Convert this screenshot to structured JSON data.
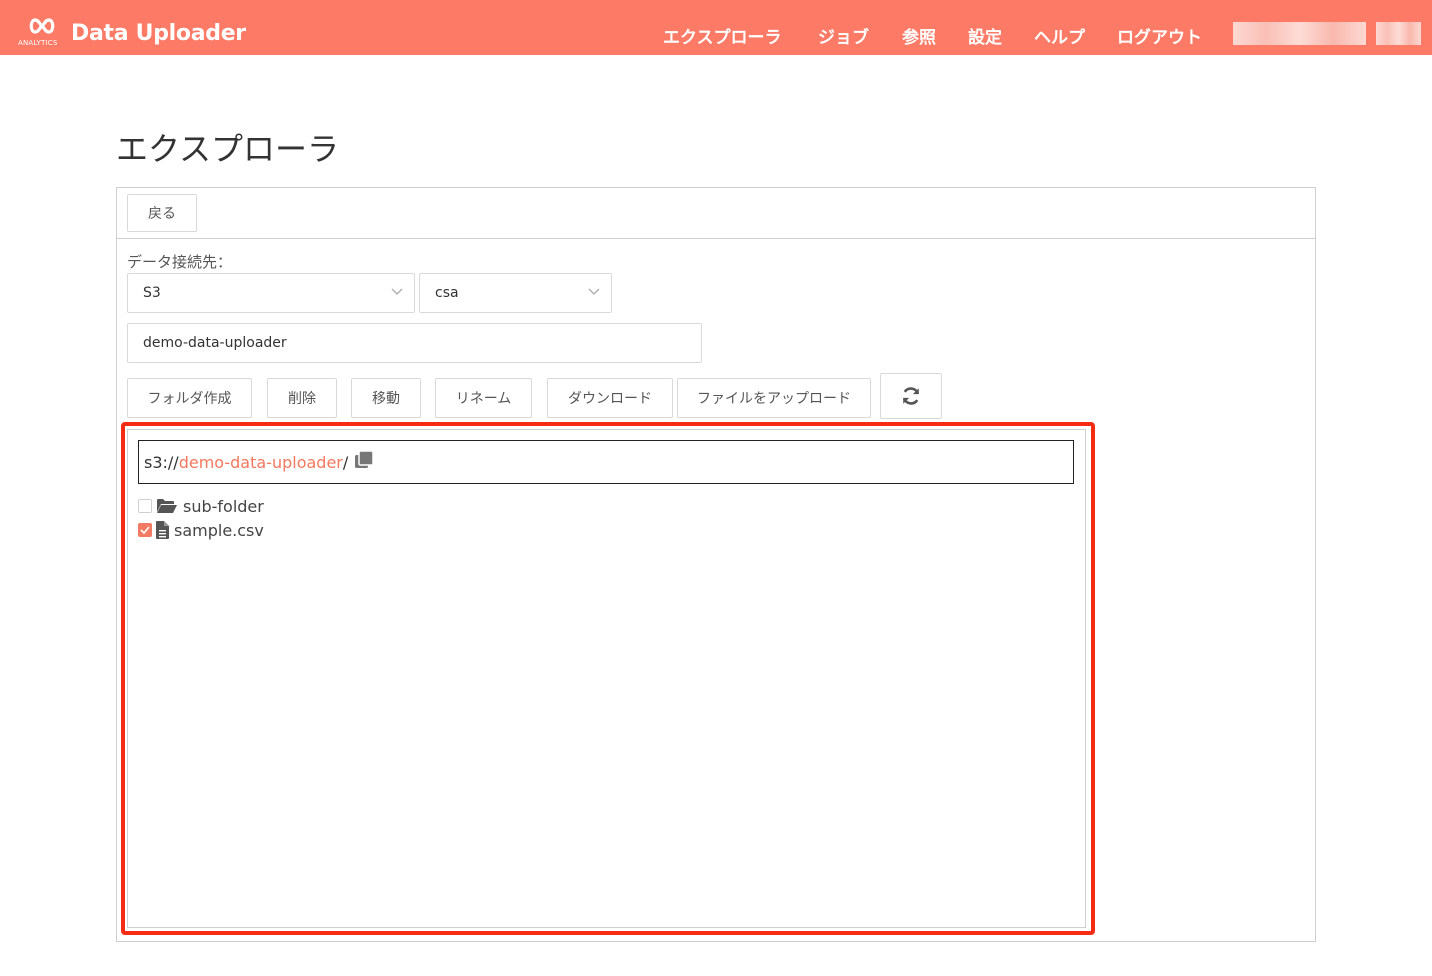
{
  "app": {
    "brand": "Data Uploader",
    "logo_text": "ANALYTICS",
    "accent_color": "#fd7a66",
    "link_color": "#f5785e",
    "highlight_color": "#f52b12"
  },
  "nav": {
    "items": [
      "エクスプローラ",
      "ジョブ",
      "参照",
      "設定",
      "ヘルプ",
      "ログアウト"
    ]
  },
  "page": {
    "title": "エクスプローラ"
  },
  "toolbar": {
    "back_label": "戻る"
  },
  "connection": {
    "label": "データ接続先：",
    "service_selected": "S3",
    "profile_selected": "csa",
    "bucket_value": "demo-data-uploader"
  },
  "actions": {
    "create_folder": "フォルダ作成",
    "delete": "削除",
    "move": "移動",
    "rename": "リネーム",
    "download": "ダウンロード",
    "upload": "ファイルをアップロード",
    "refresh_icon": "refresh-icon"
  },
  "explorer": {
    "path_prefix": "s3://",
    "path_bucket": "demo-data-uploader",
    "path_suffix": "/",
    "items": [
      {
        "name": "sub-folder",
        "type": "folder",
        "checked": false
      },
      {
        "name": "sample.csv",
        "type": "file",
        "checked": true
      }
    ]
  }
}
